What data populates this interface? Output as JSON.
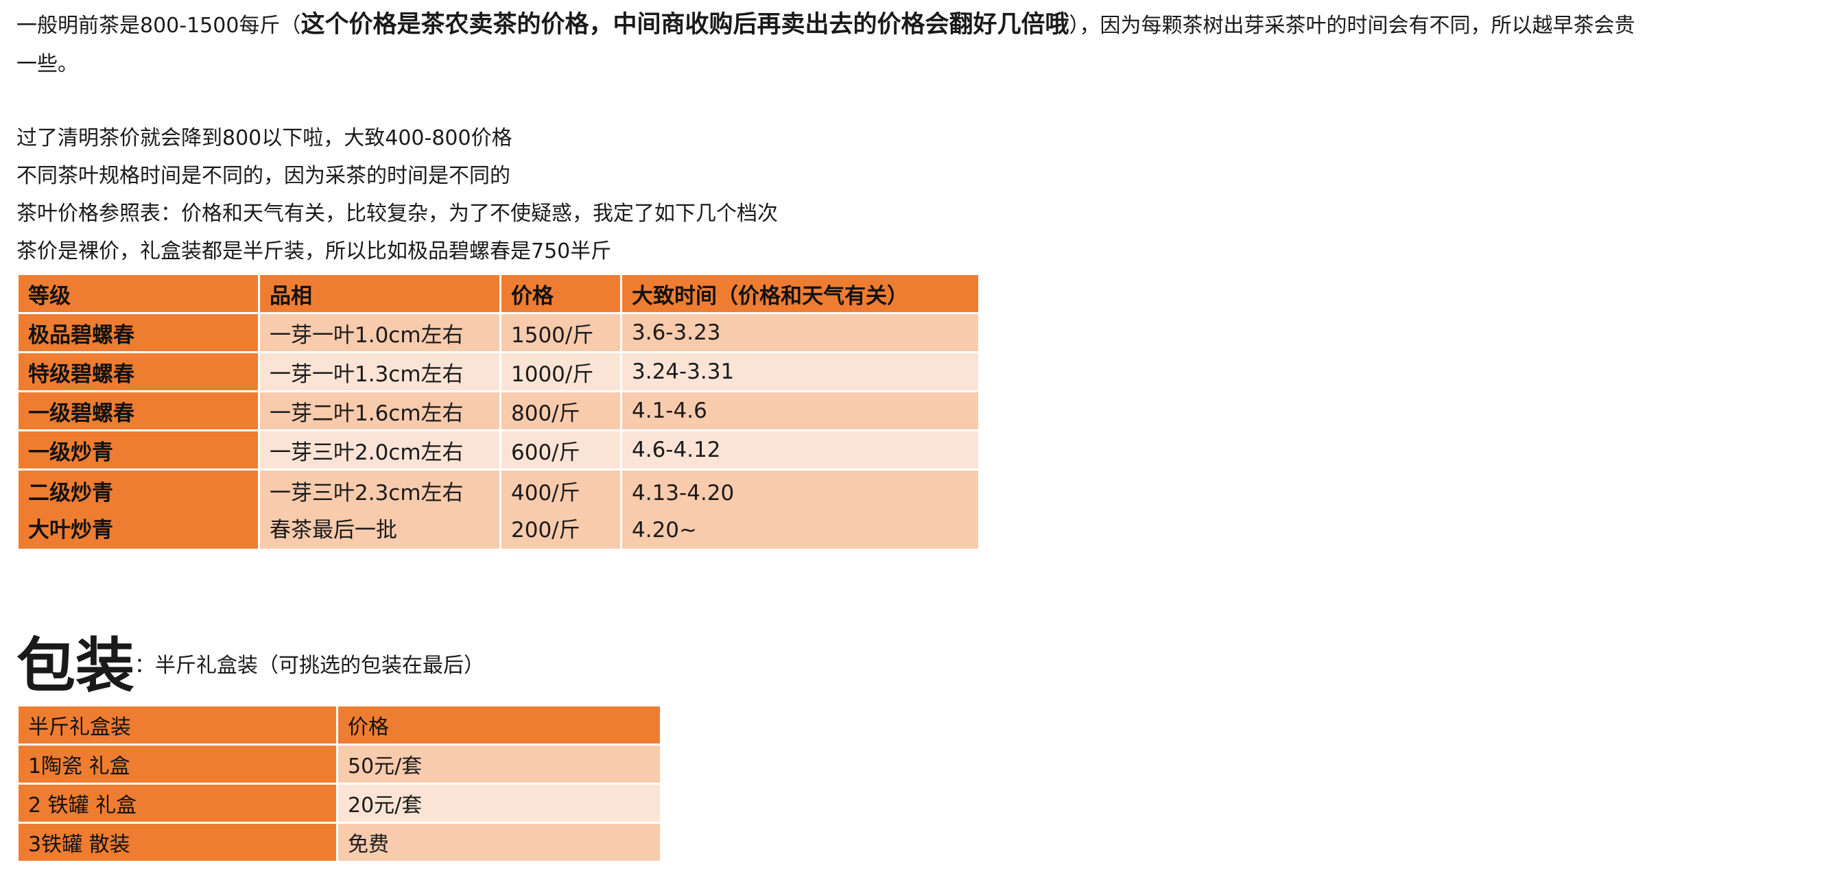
{
  "intro": {
    "line1_pre": "一般明前茶是800-1500每斤（",
    "line1_bold": "这个价格是茶农卖茶的价格，中间商收购后再卖出去的价格会翻好几倍哦",
    "line1_post": "），因为每颗茶树出芽采茶叶的时间会有不同，所以越早茶会贵",
    "line2": "一些。",
    "line3": "过了清明茶价就会降到800以下啦，大致400-800价格",
    "line4": "不同茶叶规格时间是不同的，因为采茶的时间是不同的",
    "line5": "茶叶价格参照表：价格和天气有关，比较复杂，为了不使疑惑，我定了如下几个档次",
    "line6_pre": "茶价是裸价，礼盒装都是半斤装，所以比如极品碧螺春是",
    "line6_red": "750",
    "line6_post": "半斤",
    "highlight_color": "#e3231b"
  },
  "price_table": {
    "headers": [
      "等级",
      "品相",
      "价格",
      "大致时间（价格和天气有关）"
    ],
    "rows": [
      {
        "grade": "极品碧螺春",
        "look": "一芽一叶1.0cm左右",
        "price": "1500/斤",
        "time": "3.6-3.23"
      },
      {
        "grade": "特级碧螺春",
        "look": "一芽一叶1.3cm左右",
        "price": "1000/斤",
        "time": "3.24-3.31"
      },
      {
        "grade": "一级碧螺春",
        "look": "一芽二叶1.6cm左右",
        "price": "800/斤",
        "time": "4.1-4.6"
      },
      {
        "grade": "一级炒青",
        "look": "一芽三叶2.0cm左右",
        "price": "600/斤",
        "time": "4.6-4.12"
      },
      {
        "grade": "二级炒青",
        "look": "一芽三叶2.3cm左右",
        "price": "400/斤",
        "time": "4.13-4.20"
      },
      {
        "grade": "大叶炒青",
        "look": "春茶最后一批",
        "price": "200/斤",
        "time": "4.20~"
      }
    ],
    "header_color": "#ef7d31",
    "row_color_odd": "#f8cbad",
    "row_color_even": "#fbe4d5"
  },
  "packaging": {
    "title": "包装",
    "subtitle": "：半斤礼盒装（可挑选的包装在最后）",
    "headers": [
      "半斤礼盒装",
      "价格"
    ],
    "rows": [
      {
        "name": "1陶瓷 礼盒",
        "price": "50元/套"
      },
      {
        "name": "2 铁罐 礼盒",
        "price": "20元/套"
      },
      {
        "name": "3铁罐 散装",
        "price": "免费"
      }
    ]
  }
}
